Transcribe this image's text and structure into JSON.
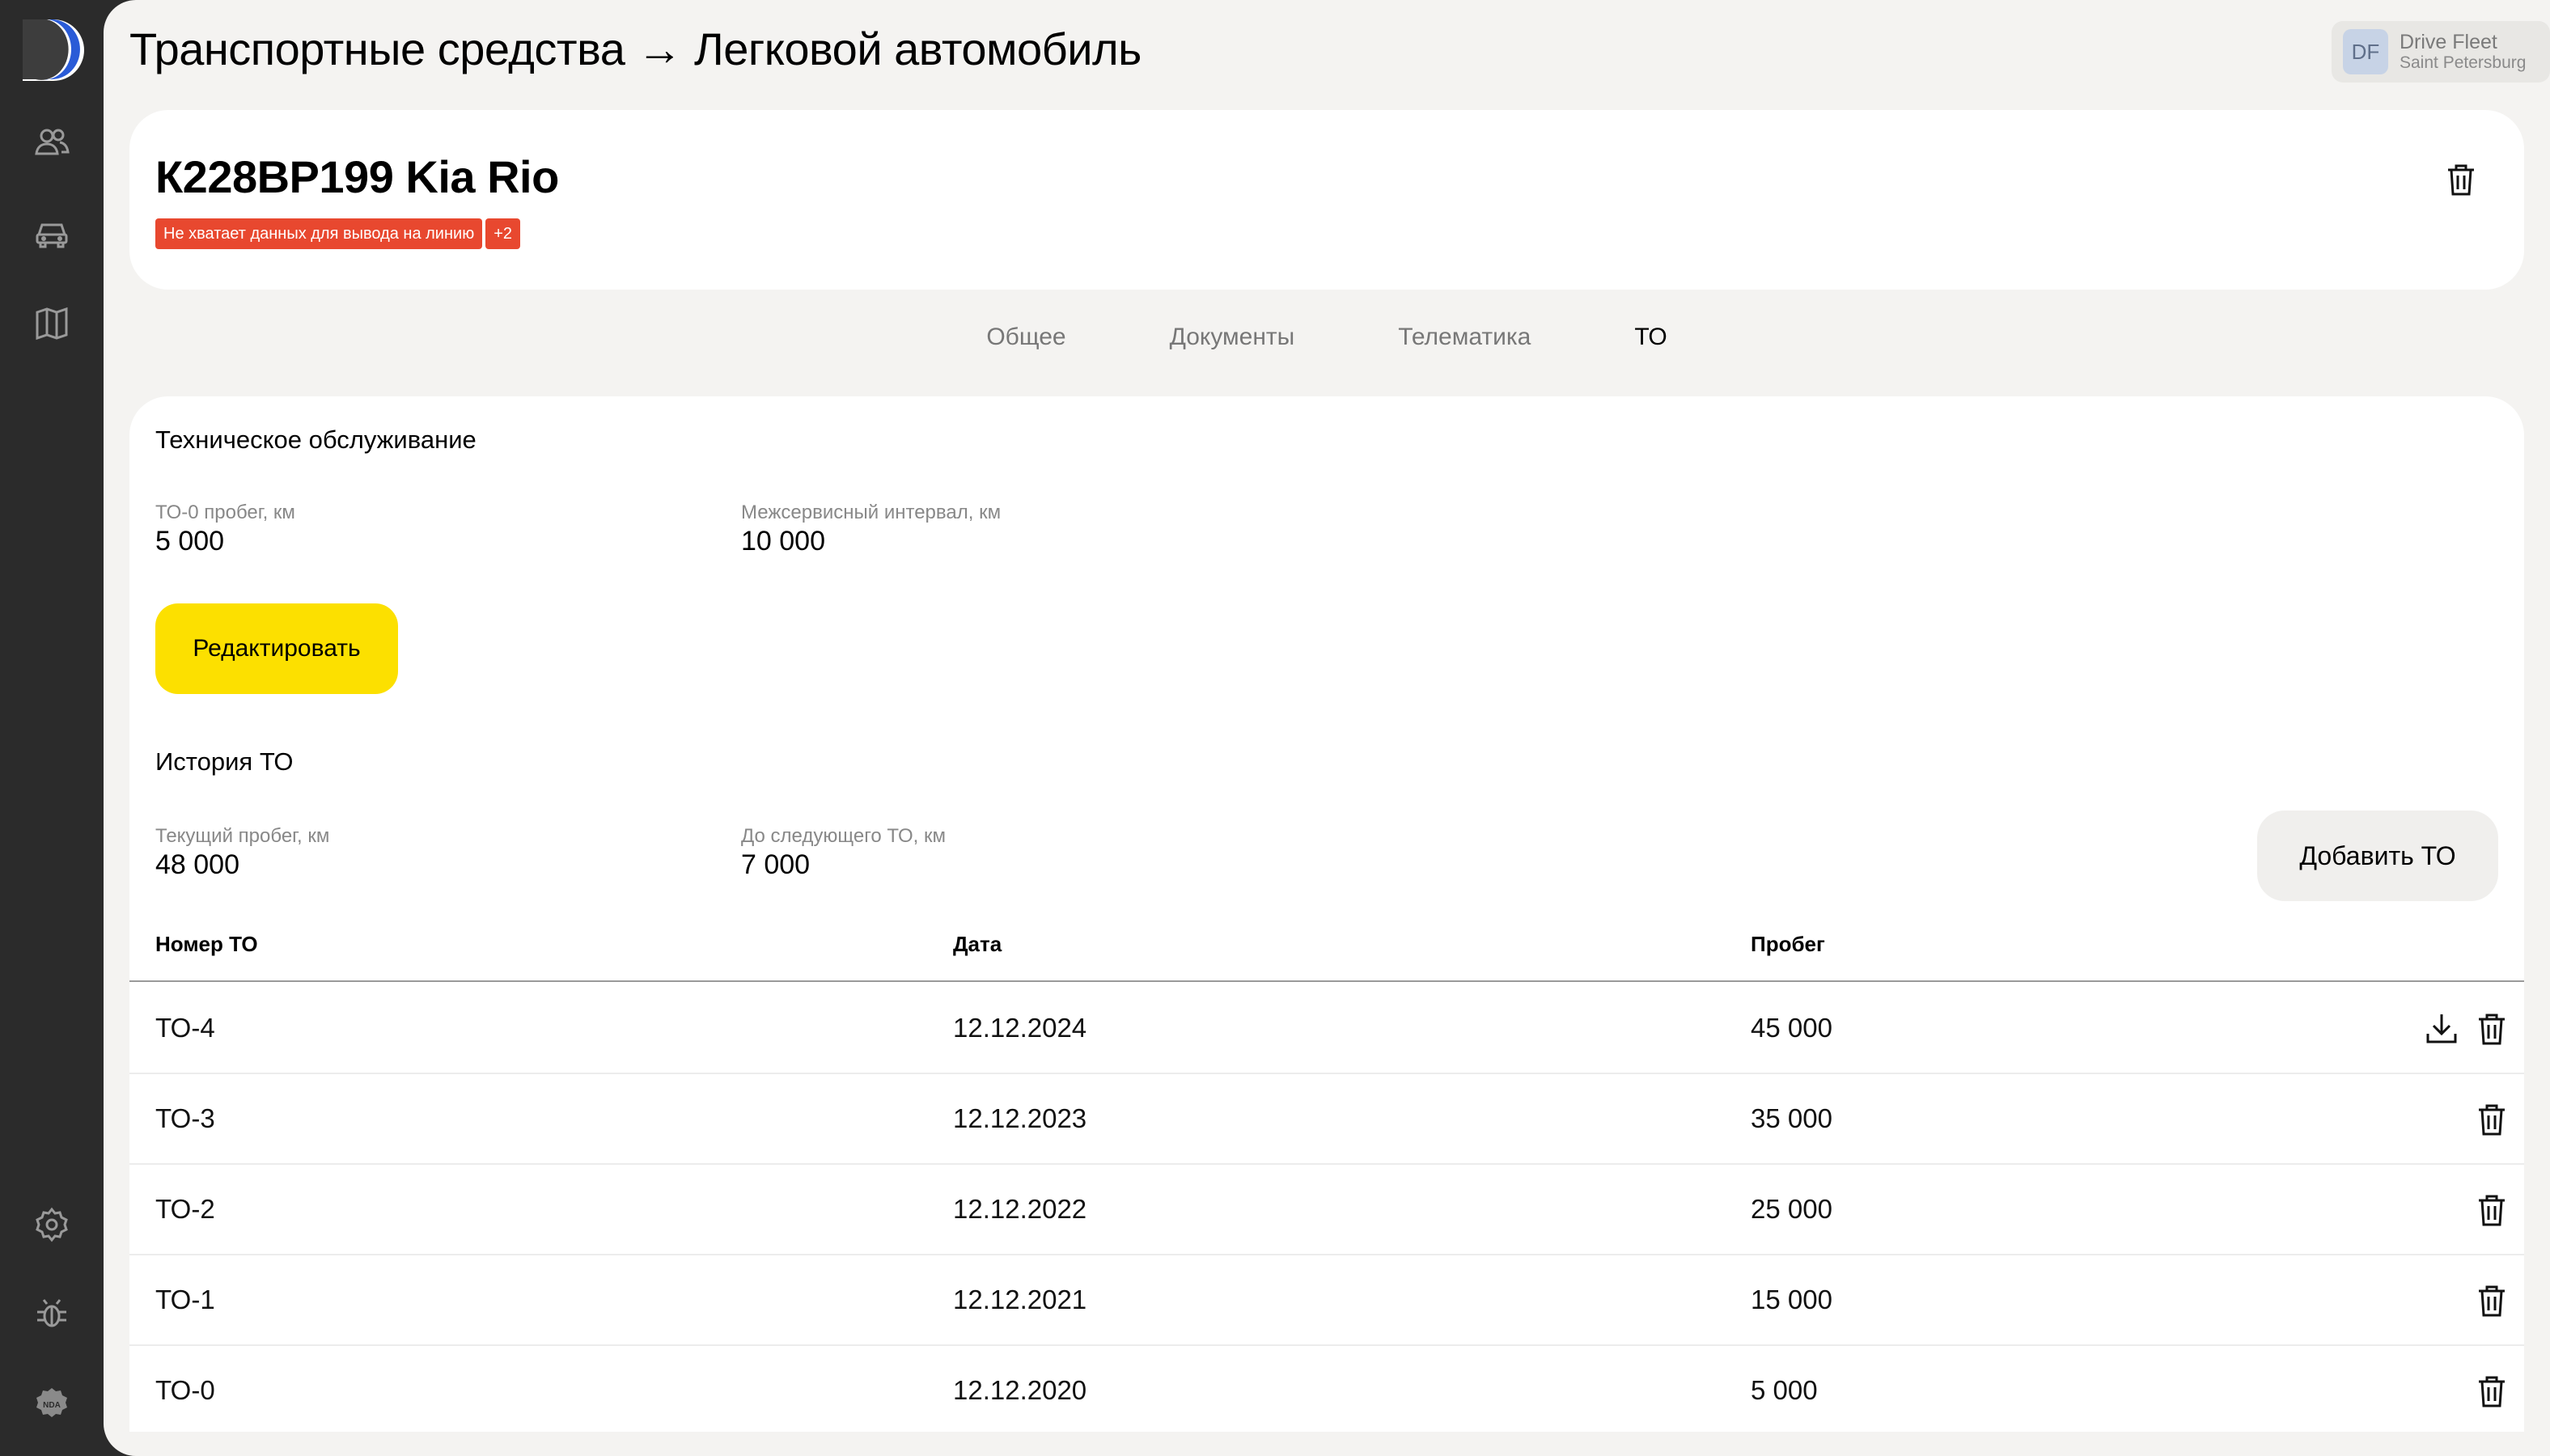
{
  "sidebar": {
    "items": [
      {
        "icon": "app-logo-icon"
      },
      {
        "icon": "users-icon"
      },
      {
        "icon": "car-icon"
      },
      {
        "icon": "map-icon"
      },
      {
        "icon": "settings-icon"
      },
      {
        "icon": "bug-icon"
      },
      {
        "icon": "nda-icon",
        "label": "NDA"
      }
    ]
  },
  "header": {
    "title": "Транспортные средства → Легковой автомобиль",
    "account": {
      "initials": "DF",
      "name": "Drive Fleet",
      "city": "Saint Petersburg"
    }
  },
  "vehicle": {
    "title": "К228ВР199 Kia Rio",
    "badges": [
      "Не хватает данных для вывода на линию",
      "+2"
    ]
  },
  "tabs": [
    {
      "label": "Общее",
      "active": false
    },
    {
      "label": "Документы",
      "active": false
    },
    {
      "label": "Телематика",
      "active": false
    },
    {
      "label": "ТО",
      "active": true
    }
  ],
  "maintenance": {
    "title": "Техническое обслуживание",
    "fields": [
      {
        "label": "ТО-0 пробег, км",
        "value": "5 000"
      },
      {
        "label": "Межсервисный интервал, км",
        "value": "10 000"
      }
    ],
    "edit_label": "Редактировать"
  },
  "history": {
    "title": "История ТО",
    "fields": [
      {
        "label": "Текущий пробег, км",
        "value": "48 000"
      },
      {
        "label": "До следующего ТО, км",
        "value": "7 000"
      }
    ],
    "add_label": "Добавить ТО",
    "columns": [
      "Номер ТО",
      "Дата",
      "Пробег"
    ],
    "rows": [
      {
        "number": "ТО-4",
        "date": "12.12.2024",
        "mileage": "45 000",
        "download": true
      },
      {
        "number": "ТО-3",
        "date": "12.12.2023",
        "mileage": "35 000",
        "download": false
      },
      {
        "number": "ТО-2",
        "date": "12.12.2022",
        "mileage": "25 000",
        "download": false
      },
      {
        "number": "ТО-1",
        "date": "12.12.2021",
        "mileage": "15 000",
        "download": false
      },
      {
        "number": "ТО-0",
        "date": "12.12.2020",
        "mileage": "5 000",
        "download": false
      }
    ]
  },
  "colors": {
    "sidebar": "#2b2b2b",
    "accent_yellow": "#fce000",
    "badge_red": "#e8482f",
    "logo_blue": "#2a5bd7"
  }
}
